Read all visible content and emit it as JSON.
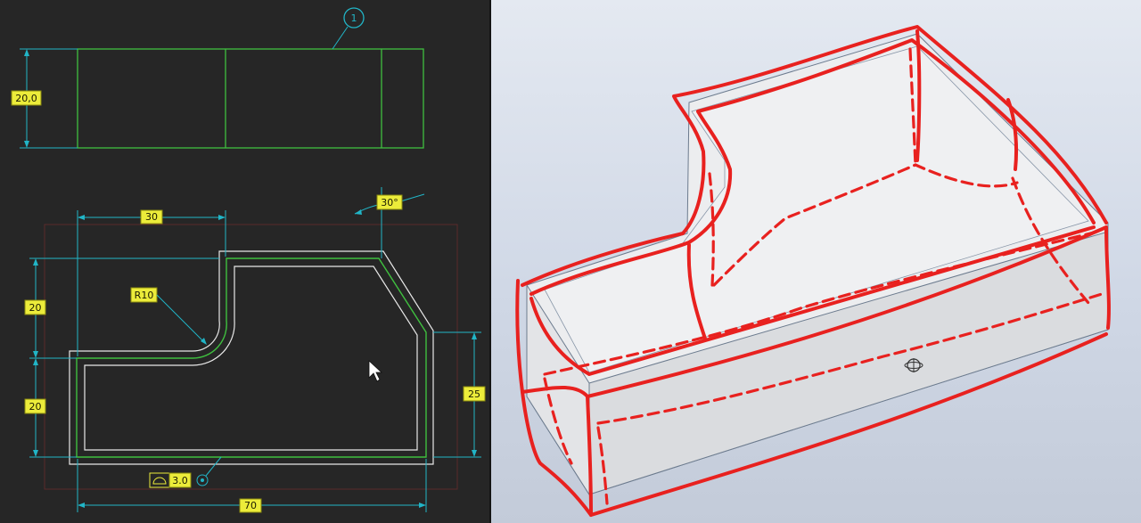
{
  "drawing": {
    "balloon": "1",
    "dims": {
      "top_height": "20,0",
      "width_top": "30",
      "angle": "30°",
      "radius": "R10",
      "left_upper": "20",
      "left_lower": "20",
      "right_height": "25",
      "overall_width": "70",
      "thickness_symbol_value": "3.0"
    }
  },
  "model": {
    "view": "3D shaded model with red sketch markup"
  },
  "colors": {
    "drawing_bg": "#262626",
    "part_edges": "#3fbf3f",
    "part_edges_light": "#e8e8e8",
    "dimension_lines": "#21b5c7",
    "dimension_box": "#ecec3a",
    "markup_red": "#e8211f",
    "model_bg": "#d6dde9"
  }
}
